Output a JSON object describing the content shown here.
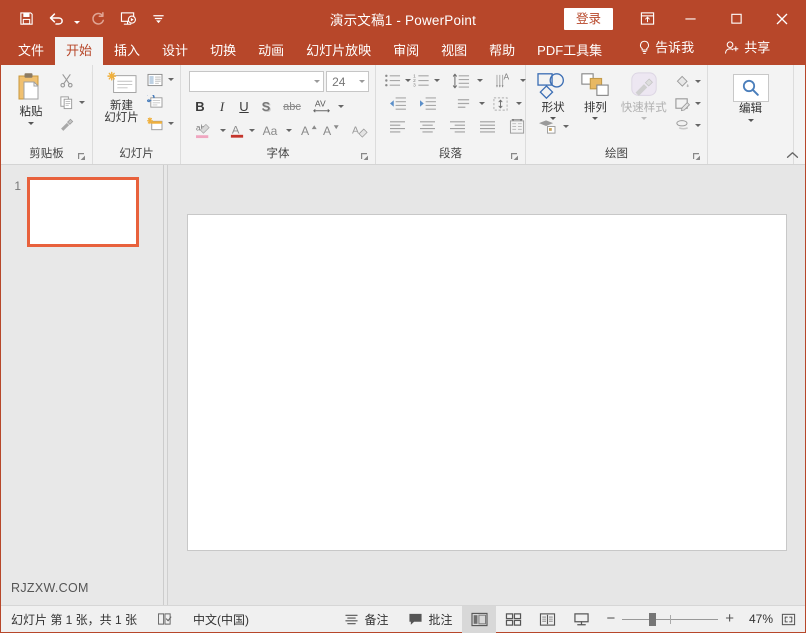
{
  "theme": {
    "accent": "#B7472A",
    "thumb_border": "#E8613C",
    "ribbon_bg": "#F3F3F3",
    "canvas_bg": "#E6E6E6"
  },
  "titlebar": {
    "document_title": "演示文稿1",
    "separator": "-",
    "app_name": "PowerPoint",
    "signin_label": "登录",
    "qat": [
      {
        "name": "save-icon",
        "tooltip": "保存"
      },
      {
        "name": "undo-icon",
        "tooltip": "撤消"
      },
      {
        "name": "redo-icon",
        "tooltip": "恢复"
      },
      {
        "name": "start-presentation-icon",
        "tooltip": "从头开始"
      },
      {
        "name": "customize-qat-icon",
        "tooltip": "自定义快速访问工具栏"
      }
    ],
    "window_controls": [
      {
        "name": "ribbon-display-options-icon",
        "glyph": "ribbon"
      },
      {
        "name": "minimize-button",
        "glyph": "minimize"
      },
      {
        "name": "maximize-button",
        "glyph": "maximize"
      },
      {
        "name": "close-button",
        "glyph": "close"
      }
    ]
  },
  "tabs": [
    {
      "label": "文件",
      "active": false
    },
    {
      "label": "开始",
      "active": true
    },
    {
      "label": "插入",
      "active": false
    },
    {
      "label": "设计",
      "active": false
    },
    {
      "label": "切换",
      "active": false
    },
    {
      "label": "动画",
      "active": false
    },
    {
      "label": "幻灯片放映",
      "active": false
    },
    {
      "label": "审阅",
      "active": false
    },
    {
      "label": "视图",
      "active": false
    },
    {
      "label": "帮助",
      "active": false
    },
    {
      "label": "PDF工具集",
      "active": false
    }
  ],
  "tellme": {
    "label": "告诉我",
    "icon": "lightbulb-icon"
  },
  "share": {
    "label": "共享",
    "icon": "share-person-icon"
  },
  "ribbon": {
    "groups": [
      {
        "id": "clipboard",
        "label": "剪贴板",
        "has_dialog_launcher": true,
        "big_button": {
          "label": "粘贴",
          "icon": "paste-icon",
          "has_dropdown": true
        },
        "small_buttons": [
          {
            "label": "剪切",
            "icon": "cut-icon"
          },
          {
            "label": "复制",
            "icon": "copy-icon",
            "has_dropdown": true
          },
          {
            "label": "格式刷",
            "icon": "format-painter-icon"
          }
        ]
      },
      {
        "id": "slides",
        "label": "幻灯片",
        "has_dialog_launcher": false,
        "big_button": {
          "label": "新建\n幻灯片",
          "label_line1": "新建",
          "label_line2": "幻灯片",
          "icon": "new-slide-icon",
          "has_dropdown": true
        },
        "small_buttons": [
          {
            "label": "版式",
            "icon": "layout-icon",
            "has_dropdown": true
          },
          {
            "label": "重设",
            "icon": "reset-slide-icon"
          },
          {
            "label": "节",
            "icon": "section-icon",
            "has_dropdown": true
          }
        ]
      },
      {
        "id": "font",
        "label": "字体",
        "has_dialog_launcher": true,
        "font_name": {
          "value": "",
          "placeholder": ""
        },
        "font_size": {
          "value": "24"
        },
        "buttons": [
          {
            "label": "加粗",
            "icon": "bold-icon",
            "glyph": "B"
          },
          {
            "label": "倾斜",
            "icon": "italic-icon",
            "glyph": "I"
          },
          {
            "label": "下划线",
            "icon": "underline-icon",
            "glyph": "U"
          },
          {
            "label": "文字阴影",
            "icon": "text-shadow-icon",
            "glyph": "S"
          },
          {
            "label": "删除线",
            "icon": "strikethrough-icon",
            "glyph": "abc"
          },
          {
            "label": "字符间距",
            "icon": "character-spacing-icon",
            "glyph": "AV",
            "has_dropdown": true
          },
          {
            "label": "文本突出显示颜色",
            "icon": "text-highlight-icon",
            "has_dropdown": true
          },
          {
            "label": "字体颜色",
            "icon": "font-color-icon",
            "has_dropdown": true
          },
          {
            "label": "更改大小写",
            "icon": "change-case-icon",
            "glyph": "Aa",
            "has_dropdown": true
          },
          {
            "label": "增大字号",
            "icon": "grow-font-icon",
            "glyph": "A"
          },
          {
            "label": "减小字号",
            "icon": "shrink-font-icon",
            "glyph": "A"
          },
          {
            "label": "清除所有格式",
            "icon": "clear-formatting-icon"
          }
        ]
      },
      {
        "id": "paragraph",
        "label": "段落",
        "has_dialog_launcher": true,
        "buttons": [
          {
            "label": "项目符号",
            "icon": "bullets-icon",
            "has_dropdown": true
          },
          {
            "label": "编号",
            "icon": "numbering-icon",
            "has_dropdown": true
          },
          {
            "label": "行距",
            "icon": "line-spacing-icon",
            "has_dropdown": true
          },
          {
            "label": "文字方向",
            "icon": "text-direction-icon",
            "has_dropdown": true
          },
          {
            "label": "减少缩进量",
            "icon": "decrease-indent-icon"
          },
          {
            "label": "增加缩进量",
            "icon": "increase-indent-icon"
          },
          {
            "label": "对齐文本",
            "icon": "align-text-icon",
            "has_dropdown": true
          },
          {
            "label": "转换为 SmartArt",
            "icon": "convert-smartart-icon",
            "has_dropdown": true
          },
          {
            "label": "左对齐",
            "icon": "align-left-icon"
          },
          {
            "label": "居中",
            "icon": "align-center-icon"
          },
          {
            "label": "右对齐",
            "icon": "align-right-icon"
          },
          {
            "label": "两端对齐",
            "icon": "justify-icon"
          },
          {
            "label": "分栏",
            "icon": "columns-icon",
            "has_dropdown": true
          }
        ]
      },
      {
        "id": "drawing",
        "label": "绘图",
        "has_dialog_launcher": true,
        "big_buttons": [
          {
            "label": "形状",
            "icon": "shapes-icon",
            "has_dropdown": true,
            "disabled": false
          },
          {
            "label": "排列",
            "icon": "arrange-icon",
            "has_dropdown": true,
            "disabled": false
          },
          {
            "label": "快速样式",
            "icon": "quick-styles-icon",
            "has_dropdown": true,
            "disabled": true
          }
        ],
        "small_buttons": [
          {
            "label": "形状填充",
            "icon": "shape-fill-icon",
            "has_dropdown": true
          },
          {
            "label": "形状轮廓",
            "icon": "shape-outline-icon",
            "has_dropdown": true
          },
          {
            "label": "形状效果",
            "icon": "shape-effects-icon",
            "has_dropdown": true
          }
        ]
      },
      {
        "id": "editing",
        "label": "编辑",
        "has_dialog_launcher": false,
        "big_button": {
          "label": "编辑",
          "icon": "find-icon",
          "has_dropdown": true
        }
      }
    ],
    "collapse_ribbon": {
      "label": "折叠功能区",
      "icon": "chevron-up-icon"
    }
  },
  "thumbnail_pane": {
    "slides": [
      {
        "number": "1",
        "selected": true
      }
    ],
    "watermark": "RJZXW.COM"
  },
  "statusbar": {
    "slide_count_text": "幻灯片 第 1 张，共 1 张",
    "spellcheck": {
      "icon": "spellcheck-icon",
      "label": "拼写检查"
    },
    "language": "中文(中国)",
    "notes": {
      "label": "备注",
      "icon": "notes-icon"
    },
    "comments": {
      "label": "批注",
      "icon": "comments-icon"
    },
    "views": [
      {
        "name": "normal-view",
        "label": "普通视图",
        "active": true
      },
      {
        "name": "slide-sorter-view",
        "label": "幻灯片浏览",
        "active": false
      },
      {
        "name": "reading-view",
        "label": "阅读视图",
        "active": false
      },
      {
        "name": "slideshow-view",
        "label": "幻灯片放映",
        "active": false
      }
    ],
    "zoom": {
      "out_label": "−",
      "in_label": "+",
      "percent": "47%",
      "fit_label": "使幻灯片适应当前窗口"
    }
  }
}
